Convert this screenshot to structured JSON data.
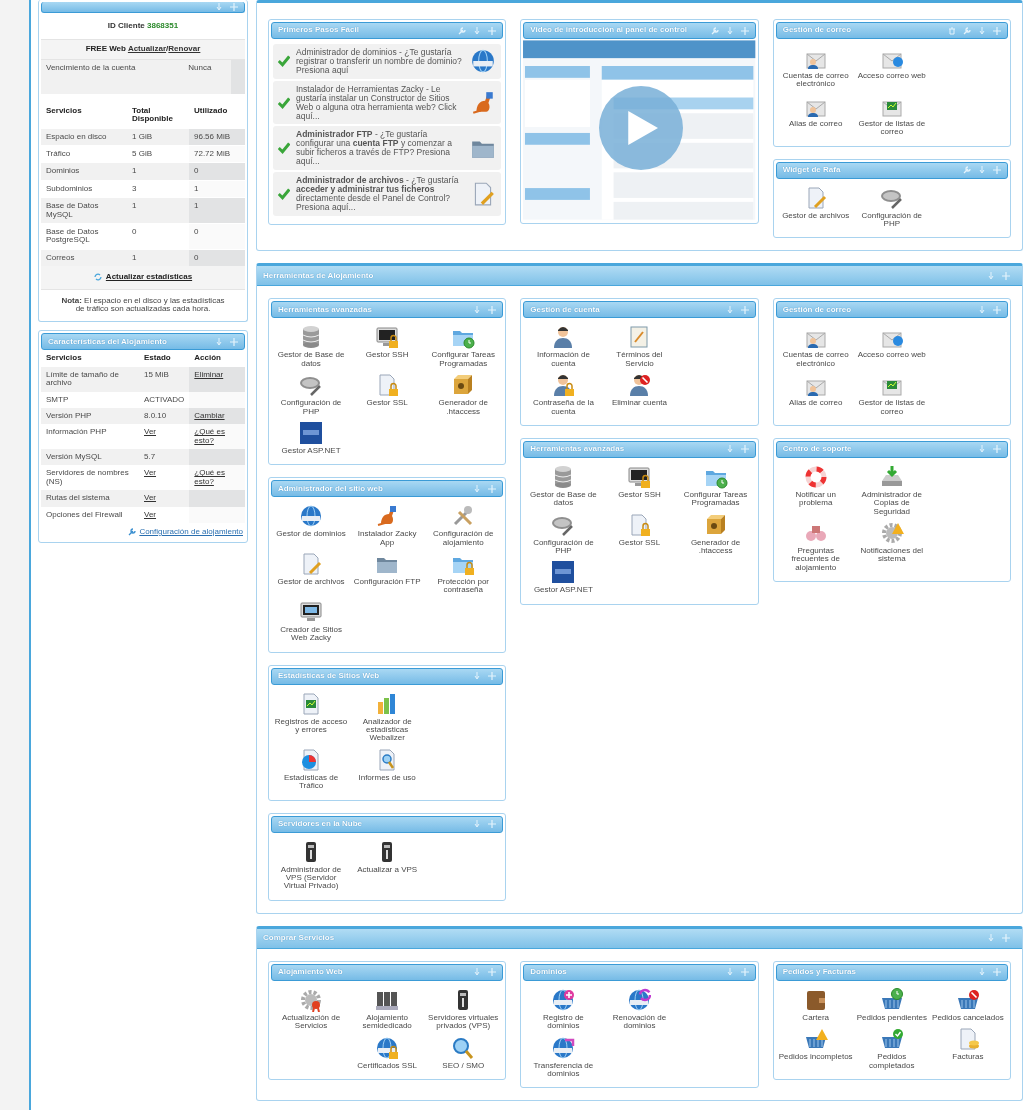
{
  "sidebar": {
    "stats": {
      "client_id_label": "ID Cliente",
      "client_id": "3868351",
      "plan": "FREE Web",
      "plan_links": [
        "Actualizar",
        "Renovar"
      ],
      "plan_link_separator": "/",
      "expiry_label": "Vencimiento de la cuenta",
      "expiry_value": "Nunca",
      "columns": [
        "Servicios",
        "Total Disponible",
        "Utilizado"
      ],
      "rows": [
        [
          "Espacio en disco",
          "1 GiB",
          "96.56 MiB"
        ],
        [
          "Tráfico",
          "5 GiB",
          "72.72 MiB"
        ],
        [
          "Dominios",
          "1",
          "0"
        ],
        [
          "Subdominios",
          "3",
          "1"
        ],
        [
          "Base de Datos MySQL",
          "1",
          "1"
        ],
        [
          "Base de Datos PostgreSQL",
          "0",
          "0"
        ],
        [
          "Correos",
          "1",
          "0"
        ]
      ],
      "refresh_link": "Actualizar estadísticas",
      "note": "**Nota:** El espacio en el disco y las estadísticas de tráfico son actualizadas cada hora."
    },
    "features": {
      "title": "Características del Alojamiento",
      "columns": [
        "Servicios",
        "Estado",
        "Acción"
      ],
      "rows": [
        {
          "service": "Límite de tamaño de archivo",
          "status": "15 MiB",
          "status_is_link": false,
          "action": "Eliminar"
        },
        {
          "service": "SMTP",
          "status": "ACTIVADO",
          "status_is_link": false
        },
        {
          "service": "Versión PHP",
          "status": "8.0.10",
          "status_is_link": false,
          "action": "Cambiar"
        },
        {
          "service": "Información PHP",
          "status": "Ver",
          "status_is_link": true,
          "action": "¿Qué es esto?"
        },
        {
          "service": "Versión MySQL",
          "status": "5.7",
          "status_is_link": false
        },
        {
          "service": "Servidores de nombres (NS)",
          "status": "Ver",
          "status_is_link": true,
          "action": "¿Qué es esto?"
        },
        {
          "service": "Rutas del sistema",
          "status": "Ver",
          "status_is_link": true
        },
        {
          "service": "Opciones del Firewall",
          "status": "Ver",
          "status_is_link": true
        }
      ],
      "footer_link": "Configuración de alojamiento"
    }
  },
  "sections": [
    {
      "columns": [
        [
          {
            "title": "Primeros Pasos Fácil",
            "removable": false,
            "configurable": true,
            "kind": "steps",
            "steps": [
              {
                "text": "Administrador de dominios - ¿Te gustaría registrar o transferir un nombre de dominio? Presiona aquí",
                "completed": true,
                "kind": "www-globe"
              },
              {
                "text": "Instalador de Herramientas Zacky - Le gustaría instalar un Constructor de Sitios Web o alguna otra herramienta web? Click aquí...",
                "completed": true,
                "kind": "mascot"
              },
              {
                "text": "**Administrador FTP** - ¿Te gustaría configurar una **cuenta FTP** y comenzar a subir ficheros a través de FTP? Presiona aquí...",
                "completed": true,
                "kind": "ftp-folder"
              },
              {
                "text": "**Administrador de archivos** - ¿Te gustaría **acceder y administrar tus ficheros** directamente desde el Panel de Control? Presiona aquí...",
                "completed": true,
                "kind": "file-manager"
              }
            ]
          }
        ],
        [
          {
            "title": "Video de introducción al panel de control",
            "removable": false,
            "configurable": true,
            "kind": "video"
          }
        ],
        [
          {
            "title": "Gestión de correo",
            "removable": true,
            "configurable": true,
            "kind": "tools",
            "rows": [
              [
                {
                  "label": "Cuentas de correo electrónico",
                  "kind": "mail-user"
                },
                {
                  "label": "Acceso correo web",
                  "kind": "mail-globe"
                }
              ],
              [
                {
                  "label": "Alias de correo",
                  "kind": "mail-group"
                },
                {
                  "label": "Gestor de listas de correo",
                  "kind": "mail-list"
                }
              ]
            ]
          },
          {
            "title": "Widget de Rafa",
            "removable": false,
            "configurable": true,
            "kind": "tools",
            "rows": [
              [
                {
                  "label": "Gestor de archivos",
                  "kind": "file-manager"
                },
                {
                  "label": "Configuración de PHP",
                  "kind": "php-tools"
                }
              ]
            ]
          }
        ]
      ]
    },
    {
      "title": "Herramientas de Alojamiento",
      "columns": [
        [
          {
            "title": "Herramientas avanzadas",
            "removable": false,
            "configurable": false,
            "kind": "tools",
            "rows": [
              [
                {
                  "label": "Gestor de Base de datos",
                  "kind": "database"
                },
                {
                  "label": "Gestor SSH",
                  "kind": "terminal"
                },
                {
                  "label": "Configurar Tareas Programadas",
                  "kind": "folder-clock"
                }
              ],
              [
                {
                  "label": "Configuración de PHP",
                  "kind": "php-tools"
                },
                {
                  "label": "Gestor SSL",
                  "kind": "certificate"
                },
                {
                  "label": "Generador de .htaccess",
                  "kind": "safe-box"
                }
              ],
              [
                {
                  "label": "Gestor ASP.NET",
                  "kind": "aspnet-logo"
                }
              ]
            ]
          },
          {
            "title": "Administrador del sitio web",
            "removable": false,
            "configurable": false,
            "kind": "tools",
            "rows": [
              [
                {
                  "label": "Gestor de dominios",
                  "kind": "www-globe"
                },
                {
                  "label": "Instalador Zacky App",
                  "kind": "mascot"
                },
                {
                  "label": "Configuración de alojamiento",
                  "kind": "tools"
                }
              ],
              [
                {
                  "label": "Gestor de archivos",
                  "kind": "file-manager"
                },
                {
                  "label": "Configuración FTP",
                  "kind": "ftp-folder"
                },
                {
                  "label": "Protección por contraseña",
                  "kind": "folder-lock"
                }
              ],
              [
                {
                  "label": "Creador de Sitios Web Zacky",
                  "kind": "site-builder"
                }
              ]
            ]
          },
          {
            "title": "Estadísticas de Sitios Web",
            "removable": false,
            "configurable": false,
            "kind": "tools",
            "rows": [
              [
                {
                  "label": "Registros de acceso y errores",
                  "kind": "log-chart"
                },
                {
                  "label": "Analizador de estadísticas Webalizer",
                  "kind": "bar-chart"
                }
              ],
              [
                {
                  "label": "Estadísticas de Tráfico",
                  "kind": "pie-chart"
                },
                {
                  "label": "Informes de uso",
                  "kind": "usage-report"
                }
              ]
            ]
          },
          {
            "title": "Servidores en la Nube",
            "removable": false,
            "configurable": false,
            "kind": "tools",
            "rows": [
              [
                {
                  "label": "Administrador de VPS (Servidor Virtual Privado)",
                  "kind": "server-tower"
                },
                {
                  "label": "Actualizar a VPS",
                  "kind": "server-tower"
                }
              ]
            ]
          }
        ],
        [
          {
            "title": "Gestión de cuenta",
            "removable": false,
            "configurable": false,
            "kind": "tools",
            "rows": [
              [
                {
                  "label": "Información de cuenta",
                  "kind": "person"
                },
                {
                  "label": "Términos del Servicio",
                  "kind": "notepad"
                }
              ],
              [
                {
                  "label": "Contraseña de la cuenta",
                  "kind": "person-lock"
                },
                {
                  "label": "Eliminar cuenta",
                  "kind": "person-delete"
                }
              ]
            ]
          },
          {
            "title": "Herramientas avanzadas",
            "removable": false,
            "configurable": false,
            "kind": "tools",
            "rows": [
              [
                {
                  "label": "Gestor de Base de datos",
                  "kind": "database"
                },
                {
                  "label": "Gestor SSH",
                  "kind": "terminal"
                },
                {
                  "label": "Configurar Tareas Programadas",
                  "kind": "folder-clock"
                }
              ],
              [
                {
                  "label": "Configuración de PHP",
                  "kind": "php-tools"
                },
                {
                  "label": "Gestor SSL",
                  "kind": "certificate"
                },
                {
                  "label": "Generador de .htaccess",
                  "kind": "safe-box"
                }
              ],
              [
                {
                  "label": "Gestor ASP.NET",
                  "kind": "aspnet-logo"
                }
              ]
            ]
          }
        ],
        [
          {
            "title": "Gestión de correo",
            "removable": false,
            "configurable": false,
            "kind": "tools",
            "rows": [
              [
                {
                  "label": "Cuentas de correo electrónico",
                  "kind": "mail-user"
                },
                {
                  "label": "Acceso correo web",
                  "kind": "mail-globe"
                }
              ],
              [
                {
                  "label": "Alias de correo",
                  "kind": "mail-group"
                },
                {
                  "label": "Gestor de listas de correo",
                  "kind": "mail-list"
                }
              ]
            ]
          },
          {
            "title": "Centro de soporte",
            "removable": false,
            "configurable": false,
            "kind": "tools",
            "rows": [
              [
                {
                  "label": "Notificar un problema",
                  "kind": "lifebuoy"
                },
                {
                  "label": "Administrador de Copias de Seguridad",
                  "kind": "backup-drive"
                }
              ],
              [
                {
                  "label": "Preguntas frecuentes de alojamiento",
                  "kind": "binoculars"
                },
                {
                  "label": "Notificaciones del sistema",
                  "kind": "gear-warning"
                }
              ]
            ]
          }
        ]
      ]
    },
    {
      "title": "Comprar Servicios",
      "columns": [
        [
          {
            "title": "Alojamiento Web",
            "removable": false,
            "configurable": false,
            "kind": "tools",
            "rows": [
              [
                {
                  "label": "Actualización de Servicios",
                  "kind": "gear-ribbon"
                },
                {
                  "label": "Alojamiento semidedicado",
                  "kind": "server-rack"
                },
                {
                  "label": "Servidores virtuales privados (VPS)",
                  "kind": "server-tower"
                }
              ],
              [
                null,
                {
                  "label": "Certificados SSL",
                  "kind": "globe-lock"
                },
                {
                  "label": "SEO / SMO",
                  "kind": "magnifier"
                }
              ]
            ]
          }
        ],
        [
          {
            "title": "Dominios",
            "removable": false,
            "configurable": false,
            "kind": "tools",
            "rows": [
              [
                {
                  "label": "Registro de dominios",
                  "kind": "globe-plus"
                },
                {
                  "label": "Renovación de dominios",
                  "kind": "globe-refresh"
                }
              ],
              [
                {
                  "label": "Transferencia de dominios",
                  "kind": "globe-transfer"
                }
              ]
            ]
          }
        ],
        [
          {
            "title": "Pedidos y Facturas",
            "removable": false,
            "configurable": false,
            "kind": "tools",
            "rows": [
              [
                {
                  "label": "Cartera",
                  "kind": "wallet"
                },
                {
                  "label": "Pedidos pendientes",
                  "kind": "basket-clock"
                },
                {
                  "label": "Pedidos cancelados",
                  "kind": "basket-cancel"
                }
              ],
              [
                {
                  "label": "Pedidos incompletos",
                  "kind": "basket-warning"
                },
                {
                  "label": "Pedidos completados",
                  "kind": "basket-check"
                },
                {
                  "label": "Facturas",
                  "kind": "invoice"
                }
              ]
            ]
          }
        ]
      ]
    }
  ]
}
